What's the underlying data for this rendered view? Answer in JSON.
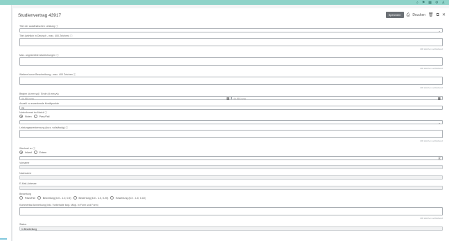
{
  "window": {
    "title": "Studienvertrag 43917",
    "top_icons": [
      "search-icon",
      "flag-icon",
      "grid-icon",
      "settings-icon",
      "user-icon"
    ]
  },
  "header_actions": {
    "save_label": "Speichern",
    "print_label": "Drucken"
  },
  "fields": {
    "ausl_leistung": {
      "label": "Titel der ausländischen Leistung",
      "info": "ⓘ",
      "value": ""
    },
    "kurs_titel": {
      "label": "Titel (wörtlich in Deutsch - max. 400 Zeichen)",
      "info": "ⓘ",
      "counter": "400 Zeichen verbleibend"
    },
    "lernziele": {
      "label": "Max. angestrebte Abweichungen",
      "info": "ⓘ",
      "counter": "400 Zeichen verbleibend"
    },
    "beschreibung": {
      "label": "Weitere kurze Beschreibung - max. 400 Zeichen",
      "info": "ⓘ",
      "counter": "400 Zeichen verbleibend"
    },
    "beginn": {
      "label": "Beginn (d.mm.yy) / Ende (d.mm.yy)",
      "from_placeholder": "dd.MM.yyyy",
      "to_placeholder": "dd.MM.yyyy"
    },
    "leistungspunkte": {
      "label": "Anzahl zu erwerbende Kreditpunkte",
      "value": "20"
    },
    "notenformat": {
      "label": "Notenformat im Modul",
      "info": "ⓘ",
      "options": [
        "Noten",
        "Pass/Fail"
      ],
      "selected": 0
    },
    "anerkennung": {
      "label": "Leistungsanerkennung (kurz, vollständig)",
      "info": "ⓘ",
      "counter": "400 Zeichen verbleibend"
    },
    "wechsel": {
      "label": "Wechsel zu",
      "info": "ⓘ",
      "options": [
        "Inland",
        "Extern"
      ],
      "selected": 0
    },
    "vorname": {
      "label": "Vorname"
    },
    "nachname": {
      "label": "Nachname"
    },
    "email": {
      "label": "E-Mail-Adresse"
    },
    "bewertung": {
      "label": "Bewertung",
      "options": [
        "Pass/Fail",
        "Bewertung (6.0 - 1.0, 0.5)",
        "Bewertung (6.0 - 1.0, 0.25)",
        "Bewertung (6.0 - 1.0, 0.10)"
      ],
      "selected": -1
    },
    "kommentar": {
      "label": "Kommentar/Anmerkung (inkl. Vorbehalte bzgl. Mögl. in Form und Form)",
      "counter": "400 Zeichen verbleibend"
    },
    "status": {
      "label": "Status",
      "value": "In Bearbeitung"
    }
  }
}
